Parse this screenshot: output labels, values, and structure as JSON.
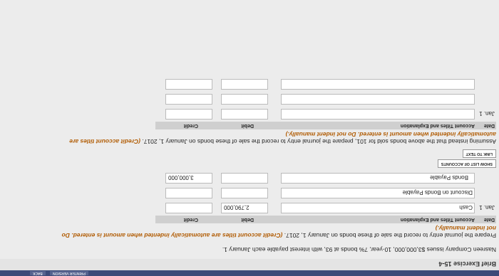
{
  "topbar": {
    "printer_version": "PRINTER VERSION",
    "back": "BACK"
  },
  "exercise_title": "Brief Exercise 15-4",
  "intro": "Nasreen Company issues $3,000,000, 10-year, 7% bonds at 93, with interest payable each January 1.",
  "part1": {
    "instruction": "Prepare the journal entry to record the sale of these bonds on January 1, 2017.",
    "note": "(Credit account titles are automatically indented when amount is entered. Do",
    "note_cont": "not indent manually.)",
    "headers": {
      "date": "Date",
      "account": "Account Titles and Explanation",
      "debit": "Debit",
      "credit": "Credit"
    },
    "rows": [
      {
        "date": "Jan. 1",
        "account": "Cash",
        "debit": "2,790,000",
        "credit": ""
      },
      {
        "date": "",
        "account": "Discount on Bonds Payable",
        "debit": "",
        "credit": ""
      },
      {
        "date": "",
        "account": "Bonds Payable",
        "debit": "",
        "credit": "3,000,000"
      }
    ]
  },
  "buttons": {
    "show_list": "SHOW LIST OF ACCOUNTS",
    "link_text": "LINK TO TEXT"
  },
  "part2": {
    "instruction": "Assuming instead that the above bonds sold for 101, prepare the journal entry to record the sale of these bonds on January 1, 2017.",
    "note": "(Credit account titles are",
    "note_cont": "automatically indented when amount is entered. Do not indent manually.)",
    "headers": {
      "date": "Date",
      "account": "Account Titles and Explanation",
      "debit": "Debit",
      "credit": "Credit"
    },
    "rows": [
      {
        "date": "Jan. 1",
        "account": "",
        "debit": "",
        "credit": ""
      },
      {
        "date": "",
        "account": "",
        "debit": "",
        "credit": ""
      },
      {
        "date": "",
        "account": "",
        "debit": "",
        "credit": ""
      }
    ]
  }
}
